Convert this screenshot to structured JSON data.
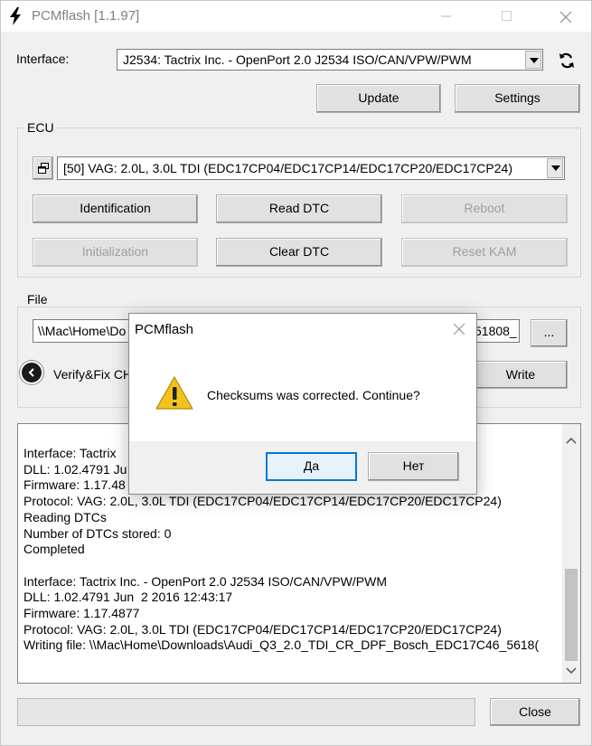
{
  "window": {
    "title": "PCMflash [1.1.97]"
  },
  "interface": {
    "label": "Interface:",
    "selected": "J2534: Tactrix Inc. - OpenPort 2.0 J2534 ISO/CAN/VPW/PWM",
    "refresh_icon": "refresh-icon"
  },
  "toolbar": {
    "update_label": "Update",
    "settings_label": "Settings"
  },
  "ecu": {
    "group_title": "ECU",
    "selected": "[50] VAG: 2.0L, 3.0L TDI (EDC17CP04/EDC17CP14/EDC17CP20/EDC17CP24)",
    "buttons": {
      "identification": "Identification",
      "read_dtc": "Read DTC",
      "reboot": "Reboot",
      "initialization": "Initialization",
      "clear_dtc": "Clear DTC",
      "reset_kam": "Reset KAM"
    }
  },
  "file": {
    "group_title": "File",
    "path_left": "\\\\Mac\\Home\\Do",
    "path_right": "51808_",
    "browse_label": "...",
    "verify_label": "Verify&Fix CH",
    "write_label": "Write"
  },
  "log": {
    "lines": [
      "Interface: Tactrix",
      "DLL: 1.02.4791 Ju",
      "Firmware: 1.17.48",
      "Protocol: VAG: 2.0L, 3.0L TDI (EDC17CP04/EDC17CP14/EDC17CP20/EDC17CP24)",
      "Reading DTCs",
      "Number of DTCs stored: 0",
      "Completed",
      "",
      "Interface: Tactrix Inc. - OpenPort 2.0 J2534 ISO/CAN/VPW/PWM",
      "DLL: 1.02.4791 Jun  2 2016 12:43:17",
      "Firmware: 1.17.4877",
      "Protocol: VAG: 2.0L, 3.0L TDI (EDC17CP04/EDC17CP14/EDC17CP20/EDC17CP24)",
      "Writing file: \\\\Mac\\Home\\Downloads\\Audi_Q3_2.0_TDI_CR_DPF_Bosch_EDC17C46_5618("
    ]
  },
  "footer": {
    "close_label": "Close"
  },
  "dialog": {
    "title": "PCMflash",
    "message": "Checksums was corrected. Continue?",
    "yes_label": "Да",
    "no_label": "Нет",
    "icon": "warning-icon"
  },
  "colors": {
    "accent": "#0078d7",
    "warning": "#f4c21d"
  }
}
